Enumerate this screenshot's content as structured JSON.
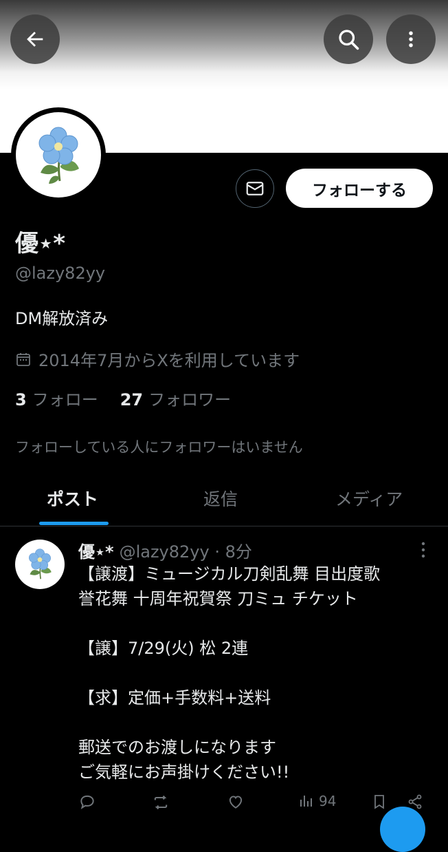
{
  "header": {
    "back_icon": "arrow-left-icon",
    "search_icon": "search-icon",
    "more_icon": "more-vertical-icon"
  },
  "profile": {
    "display_name": "優⋆*",
    "handle": "@lazy82yy",
    "bio": "DM解放済み",
    "joined": "2014年7月からXを利用しています",
    "following_count": "3",
    "following_label": "フォロー",
    "followers_count": "27",
    "followers_label": "フォロワー",
    "mutual_note": "フォローしている人にフォロワーはいません",
    "follow_button": "フォローする",
    "message_icon": "mail-icon"
  },
  "tabs": [
    {
      "label": "ポスト",
      "active": true
    },
    {
      "label": "返信",
      "active": false
    },
    {
      "label": "メディア",
      "active": false
    }
  ],
  "post": {
    "name": "優⋆*",
    "meta": "@lazy82yy · 8分",
    "lines": [
      "【譲渡】ミュージカル刀剣乱舞 目出度歌",
      "誉花舞 十周年祝賀祭 刀ミュ チケット",
      "",
      "【譲】7/29(火) 松 2連",
      "",
      "【求】定価+手数料+送料",
      "",
      "郵送でのお渡しになります",
      "ご気軽にお声掛けください!!"
    ],
    "views": "94"
  },
  "colors": {
    "accent": "#1d9bf0",
    "background": "#000000",
    "muted_text": "#71767b",
    "primary_text": "#e7e9ea"
  }
}
